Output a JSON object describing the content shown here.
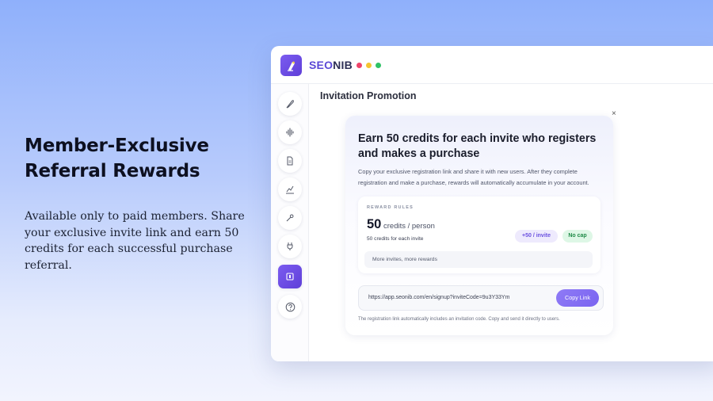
{
  "hero": {
    "title_line1": "Member-Exclusive",
    "title_line2": "Referral Rewards",
    "description": "Available only to paid members. Share your exclusive invite link and earn 50 credits for each successful purchase referral."
  },
  "app": {
    "brand_part1": "SEO",
    "brand_part2": "NIB",
    "window_dots": [
      "#ef4469",
      "#f5c431",
      "#2fc266"
    ],
    "accent": "#6a50e0",
    "sidebar_icons": [
      "feather-icon",
      "audio-wave-icon",
      "document-icon",
      "pen-chart-icon",
      "magic-wand-icon",
      "plug-icon",
      "gift-icon",
      "help-icon"
    ],
    "active_sidebar_icon": "gift-icon"
  },
  "main": {
    "title": "Invitation Promotion",
    "close_label": "×"
  },
  "card": {
    "title": "Earn 50 credits for each invite who registers and makes a purchase",
    "description": "Copy your exclusive registration link and share it with new users. After they complete registration and make a purchase, rewards will automatically accumulate in your account.",
    "rules_label": "REWARD RULES",
    "amount": "50",
    "amount_unit": "credits / person",
    "rule_sub": "50 credits for each invite",
    "pill_rate": "+50 / invite",
    "pill_cap": "No cap",
    "more_text": "More invites, more rewards",
    "invite_url": "https://app.seonib.com/en/signup?inviteCode=9u3Y33Ym",
    "copy_label": "Copy Link",
    "note": "The registration link automatically includes an invitation code. Copy and send it directly to users."
  }
}
